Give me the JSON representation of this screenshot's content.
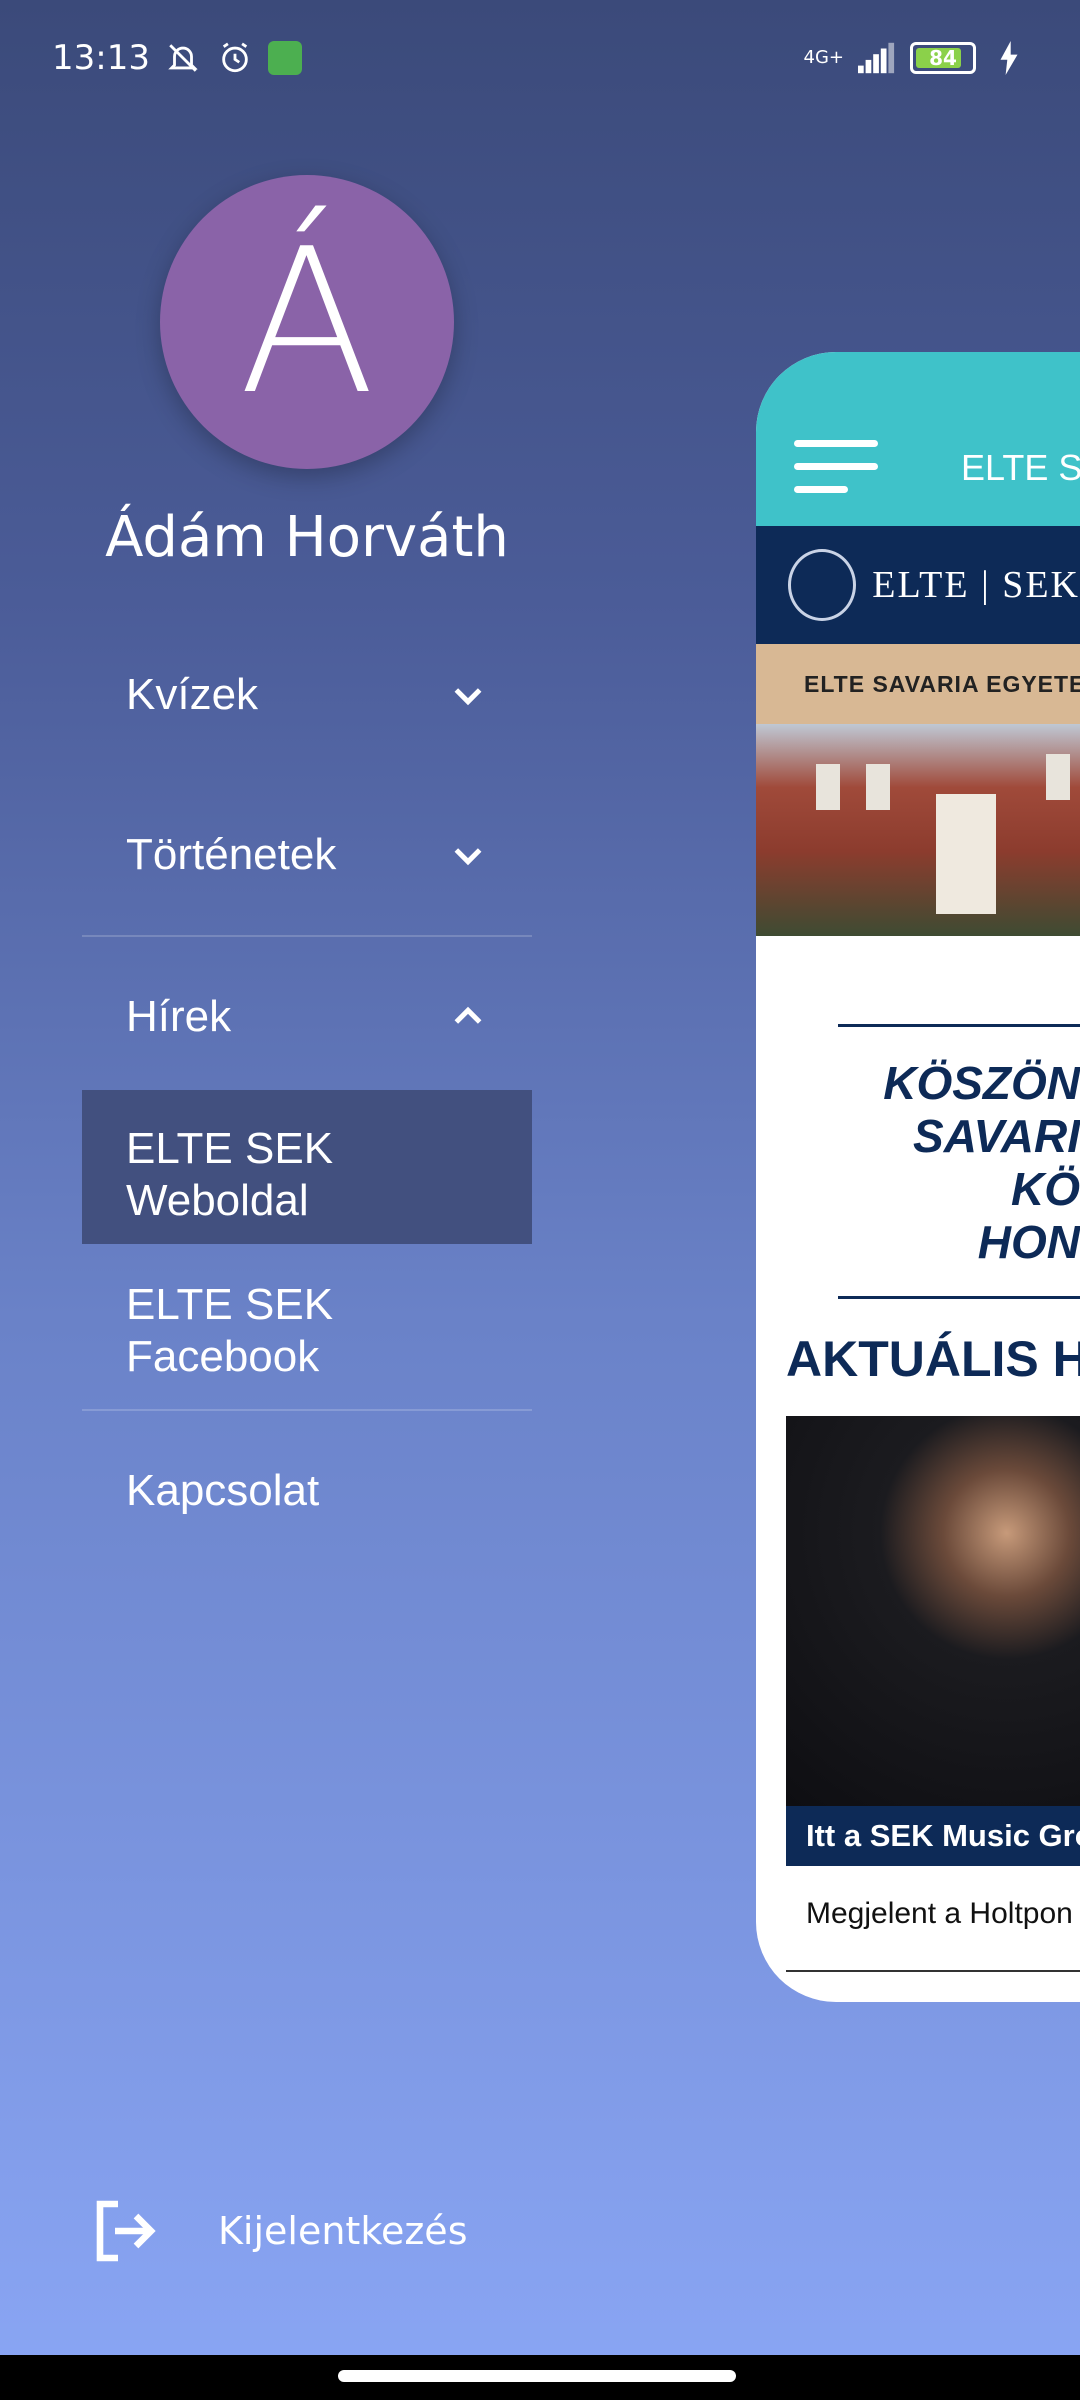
{
  "status_bar": {
    "time": "13:13",
    "network": "4G+",
    "battery": "84",
    "battery_level": 0.84,
    "icons": [
      "bell-off-icon",
      "alarm-icon",
      "app-notification-icon",
      "signal-icon",
      "charging-icon"
    ]
  },
  "profile": {
    "avatar_letter": "Á",
    "name": "Ádám Horváth",
    "avatar_color": "#8a63a8"
  },
  "menu": {
    "items": [
      {
        "label": "Kvízek",
        "expanded": false
      },
      {
        "label": "Történetek",
        "expanded": false
      },
      {
        "label": "Hírek",
        "expanded": true
      }
    ],
    "sub_items": [
      {
        "label": "ELTE SEK Weboldal",
        "active": true
      },
      {
        "label": "ELTE SEK Facebook",
        "active": false
      }
    ],
    "contact": "Kapcsolat",
    "logout": "Kijelentkezés"
  },
  "preview": {
    "header_title": "ELTE S",
    "logo_text": "ELTE | SEK",
    "banner": "ELTE SAVARIA EGYETE",
    "heading_lines": [
      "KÖSZÖN",
      "SAVARI",
      "KÖ",
      "HON"
    ],
    "news_title": "AKTUÁLIS HÍR",
    "news_caption": "Itt a SEK Music Grou",
    "news_excerpt": "Megjelent a Holtpon",
    "colors": {
      "header": "#3fc2c9",
      "navy": "#0d2a57",
      "banner": "#d8b894"
    }
  }
}
